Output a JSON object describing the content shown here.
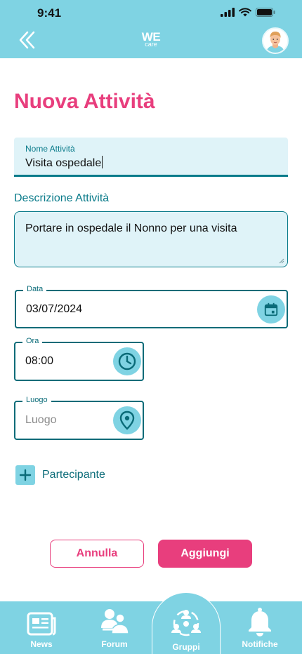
{
  "status": {
    "time": "9:41"
  },
  "header": {
    "logo_top": "WE",
    "logo_bottom": "care"
  },
  "page": {
    "title": "Nuova Attività"
  },
  "form": {
    "name": {
      "label": "Nome Attività",
      "value": "Visita ospedale"
    },
    "description": {
      "label": "Descrizione Attività",
      "value": "Portare in ospedale il Nonno per una visita"
    },
    "date": {
      "label": "Data",
      "value": "03/07/2024"
    },
    "time": {
      "label": "Ora",
      "value": "08:00"
    },
    "place": {
      "label": "Luogo",
      "placeholder": "Luogo"
    },
    "add_participant": "Partecipante"
  },
  "actions": {
    "cancel": "Annulla",
    "add": "Aggiungi"
  },
  "nav": {
    "items": [
      {
        "label": "News",
        "icon": "news-icon"
      },
      {
        "label": "Forum",
        "icon": "forum-icon"
      },
      {
        "label": "Gruppi",
        "icon": "groups-icon",
        "active": true
      },
      {
        "label": "Notifiche",
        "icon": "bell-icon"
      }
    ]
  },
  "colors": {
    "accent": "#e83e7d",
    "primary": "#7fd3e3",
    "teal": "#0a7b8a",
    "field_bg": "#dff3f8"
  }
}
